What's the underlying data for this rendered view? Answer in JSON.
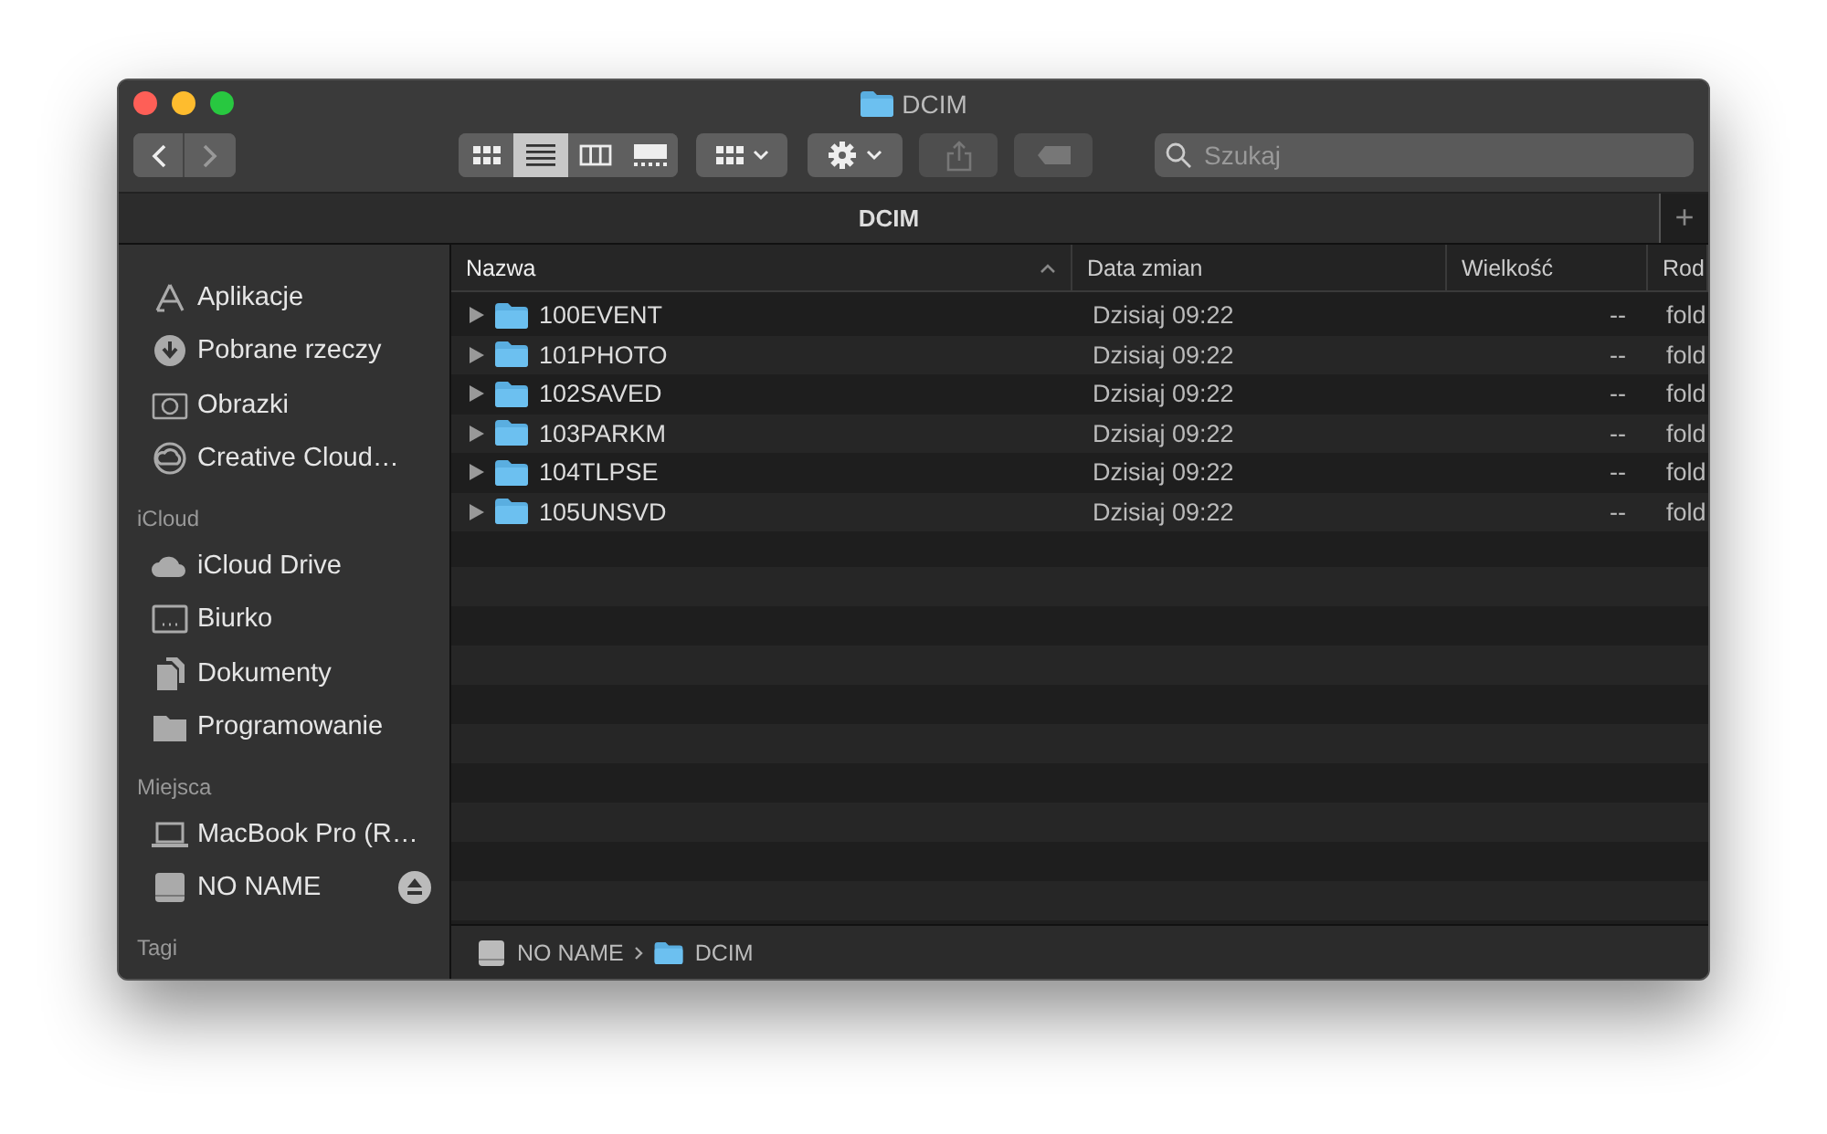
{
  "window": {
    "title": "DCIM"
  },
  "toolbar": {
    "back": {
      "disabled": false
    },
    "forward": {
      "disabled": true
    },
    "view_modes": [
      {
        "selected": false
      },
      {
        "selected": true
      },
      {
        "selected": false
      },
      {
        "selected": false
      }
    ],
    "share": {
      "disabled": true
    },
    "tags": {
      "disabled": true
    },
    "search": {
      "placeholder": "Szukaj"
    }
  },
  "tab_bar": {
    "tabs": [
      {
        "label": "DCIM",
        "selected": true
      }
    ],
    "add": "+"
  },
  "sidebar": {
    "sections": [
      {
        "items": [
          {
            "label": "Aplikacje"
          },
          {
            "label": "Pobrane rzeczy"
          },
          {
            "label": "Obrazki"
          },
          {
            "label": "Creative Cloud…"
          }
        ]
      },
      {
        "title": "iCloud",
        "items": [
          {
            "label": "iCloud Drive"
          },
          {
            "label": "Biurko"
          },
          {
            "label": "Dokumenty"
          },
          {
            "label": "Programowanie"
          }
        ]
      },
      {
        "title": "Miejsca",
        "items": [
          {
            "label": "MacBook Pro (R…",
            "ejectable": false
          },
          {
            "label": "NO NAME",
            "ejectable": true
          }
        ]
      },
      {
        "title": "Tagi"
      }
    ]
  },
  "table": {
    "columns": [
      {
        "label": "Nazwa",
        "sorted": true
      },
      {
        "label": "Data zmian",
        "sorted": false
      },
      {
        "label": "Wielkość",
        "sorted": false
      },
      {
        "label": "Rod",
        "sorted": false
      }
    ],
    "rows": [
      {
        "name": "100EVENT",
        "date": "Dzisiaj 09:22",
        "size": "--",
        "kind": "fold",
        "expanded": false
      },
      {
        "name": "101PHOTO",
        "date": "Dzisiaj 09:22",
        "size": "--",
        "kind": "fold",
        "expanded": false
      },
      {
        "name": "102SAVED",
        "date": "Dzisiaj 09:22",
        "size": "--",
        "kind": "fold",
        "expanded": false
      },
      {
        "name": "103PARKM",
        "date": "Dzisiaj 09:22",
        "size": "--",
        "kind": "fold",
        "expanded": false
      },
      {
        "name": "104TLPSE",
        "date": "Dzisiaj 09:22",
        "size": "--",
        "kind": "fold",
        "expanded": false
      },
      {
        "name": "105UNSVD",
        "date": "Dzisiaj 09:22",
        "size": "--",
        "kind": "fold",
        "expanded": false
      }
    ]
  },
  "path_bar": [
    {
      "label": "NO NAME",
      "kind": "drive"
    },
    {
      "label": "DCIM",
      "kind": "folder"
    }
  ]
}
